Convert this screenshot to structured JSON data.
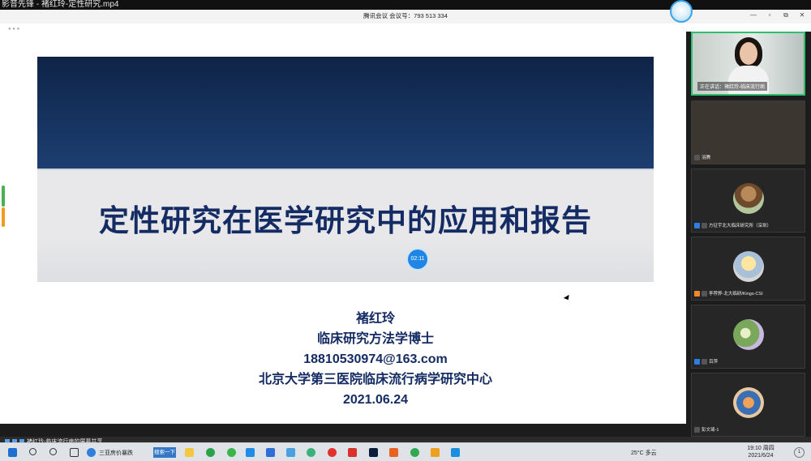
{
  "player": {
    "title": "影音先锋 - 褚红玲-定性研究.mp4"
  },
  "meeting": {
    "title": "腾讯会议 会议号：793 513 334",
    "window_buttons": [
      "—",
      "▫",
      "⧉",
      "✕"
    ]
  },
  "slide": {
    "title": "定性研究在医学研究中的应用和报告",
    "time_badge": "02:11",
    "author_lines": [
      "褚红玲",
      "临床研究方法学博士",
      "18810530974@163.com",
      "北京大学第三医院临床流行病学研究中心",
      "2021.06.24"
    ]
  },
  "participants": [
    {
      "label": "正在讲话：褚红玲-临床流行病",
      "type": "video"
    },
    {
      "label": "羽腾",
      "type": "dark"
    },
    {
      "label": "方征宇北大临床研究所（深圳）",
      "type": "avatar",
      "avatar": "av1"
    },
    {
      "label": "李荐骅-北大临研/Kings-CSI",
      "type": "avatar",
      "avatar": "av2"
    },
    {
      "label": "百萍",
      "type": "avatar",
      "avatar": "av3"
    },
    {
      "label": "彭文琦-1",
      "type": "avatar",
      "avatar": "av4"
    }
  ],
  "share_status": "褚红玲-临床流行病的屏幕共享",
  "taskbar": {
    "window_label": "三亚房价暴跌",
    "search_button": "搜索一下",
    "weather": "25°C 多云",
    "time": "19:10 周四",
    "date": "2021/6/24",
    "notification": "1"
  }
}
